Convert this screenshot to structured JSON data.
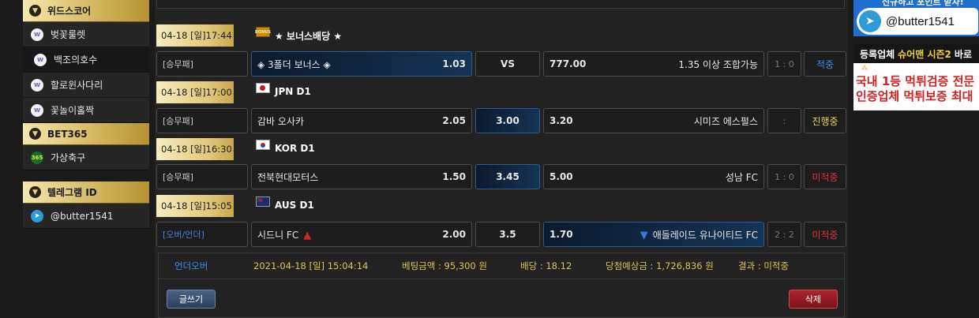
{
  "sidebar": {
    "sections": [
      {
        "title": "위드스코어",
        "items": [
          {
            "label": "벚꽃룰렛",
            "icon": "w-icon"
          },
          {
            "label": "백조의호수",
            "icon": "w-icon"
          },
          {
            "label": "할로윈사다리",
            "icon": "w-icon"
          },
          {
            "label": "꽃놀이홀짝",
            "icon": "w-icon"
          }
        ]
      },
      {
        "title": "BET365",
        "items": [
          {
            "label": "가상축구",
            "icon": "bet365-icon",
            "icon_text": "365"
          }
        ]
      },
      {
        "title": "텔레그램 ID",
        "items": [
          {
            "label": "@butter1541",
            "icon": "telegram-icon"
          }
        ]
      }
    ]
  },
  "bets": [
    {
      "time": "04-18 [일]17:44",
      "league": "★ 보너스배당 ★",
      "flag": "bonus",
      "flag_text": "BONUS",
      "type": "[승무패]",
      "home": "◈ 3폴더 보너스 ◈",
      "home_odds": "1.03",
      "mid": "VS",
      "away_odds": "777.00",
      "away": "1.35 이상 조합가능",
      "score": "1 : 0",
      "status": "적중",
      "status_color": "#3d8ff0",
      "selected": "home"
    },
    {
      "time": "04-18 [일]17:00",
      "league": "JPN D1",
      "flag": "jpn",
      "type": "[승무패]",
      "home": "감바 오사카",
      "home_odds": "2.05",
      "mid": "3.00",
      "away_odds": "3.20",
      "away": "시미즈 에스펄스",
      "score": ":",
      "status": "진행중",
      "status_color": "#e8d34a",
      "selected": "mid"
    },
    {
      "time": "04-18 [일]16:30",
      "league": "KOR D1",
      "flag": "kor",
      "type": "[승무패]",
      "home": "전북현대모터스",
      "home_odds": "1.50",
      "mid": "3.45",
      "away_odds": "5.00",
      "away": "성남 FC",
      "score": "1 : 0",
      "status": "미적중",
      "status_color": "#e0333c",
      "selected": "mid"
    },
    {
      "time": "04-18 [일]15:05",
      "league": "AUS D1",
      "flag": "aus",
      "type": "[오버/언더]",
      "home": "시드니 FC",
      "home_arrow": "▲",
      "home_odds": "2.00",
      "mid": "3.5",
      "away_odds": "1.70",
      "away_arrow": "▼",
      "away": "애들레이드 유나이티드 FC",
      "score": "2 : 2",
      "status": "미적중",
      "status_color": "#e0333c",
      "selected": "away"
    }
  ],
  "summary": {
    "game_type": "언더오버",
    "datetime": "2021-04-18 [일] 15:04:14",
    "bet_amount": "베팅금액 : 95,300 원",
    "odds": "배당 : 18.12",
    "expected_win": "당첨예상금 : 1,726,836 원",
    "result": "결과 : 미적중"
  },
  "buttons": {
    "write": "글쓰기",
    "delete": "삭제"
  },
  "banners": {
    "telegram_top_text": "신규하고 포인트 받자!",
    "telegram_handle": "@butter1541",
    "ad_bar_a": "등록업체",
    "ad_bar_b": "슈어맨 시즌2",
    "ad_bar_c": "바로",
    "ad_line1": "국내 1등 먹튀검증 전문",
    "ad_line2": "인증업체 먹튀보증 최대"
  },
  "colors": {
    "gold": "#d5b962",
    "selected_blue": "#143457",
    "win_blue": "#3d8ff0",
    "lose_red": "#e0333c",
    "progress_yellow": "#e8d34a"
  }
}
